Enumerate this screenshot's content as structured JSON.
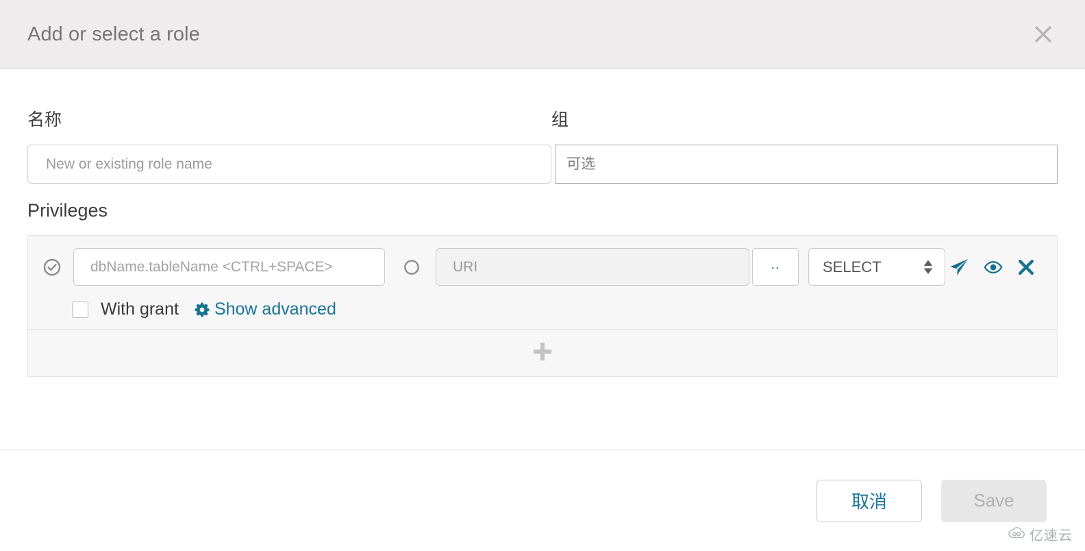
{
  "header": {
    "title": "Add or select a role",
    "close_icon": "close-icon"
  },
  "form": {
    "name_label": "名称",
    "group_label": "组",
    "name_placeholder": "New or existing role name",
    "name_value": "",
    "group_placeholder": "可选",
    "group_value": ""
  },
  "privileges": {
    "section_title": "Privileges",
    "rows": [
      {
        "scope_selected": "db",
        "db_placeholder": "dbName.tableName <CTRL+SPACE>",
        "db_value": "",
        "uri_placeholder": "URI",
        "uri_value": "",
        "browse_label": "..",
        "privilege_selected": "SELECT",
        "privilege_options": [
          "SELECT"
        ],
        "with_grant_label": "With grant",
        "with_grant_checked": false,
        "show_advanced_label": "Show advanced",
        "actions": [
          "send-icon",
          "eye-icon",
          "remove-icon"
        ]
      }
    ],
    "add_row_icon": "plus-icon"
  },
  "footer": {
    "cancel_label": "取消",
    "save_label": "Save",
    "save_disabled": true
  },
  "watermark": {
    "text": "亿速云"
  },
  "colors": {
    "accent": "#1a7499",
    "header_bg": "#efeced",
    "panel_bg": "#f7f7f7",
    "title_text": "#7a7477",
    "body_text": "#3d3d3d",
    "disabled_text": "#b0b0b0"
  }
}
